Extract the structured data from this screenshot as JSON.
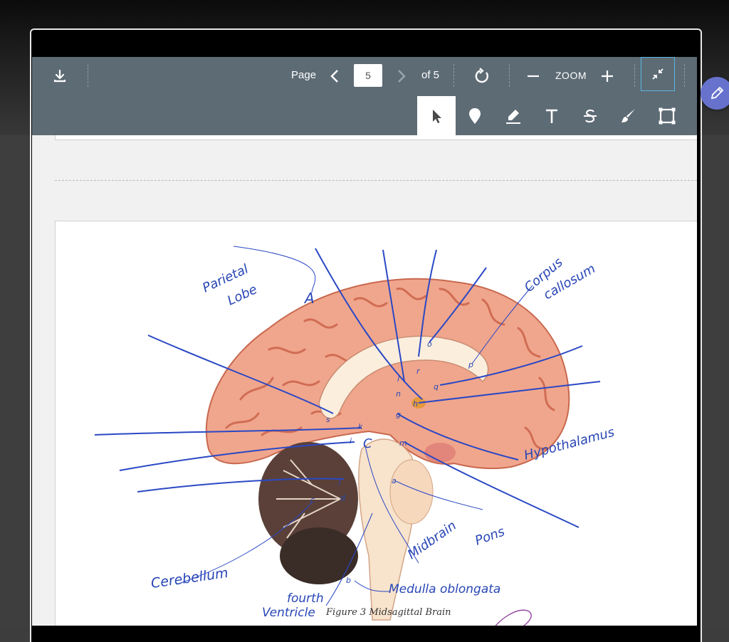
{
  "toolbar": {
    "page_label": "Page",
    "page_value": "5",
    "of_label": "of 5",
    "zoom_label": "ZOOM",
    "icons": [
      "download-icon",
      "chevron-left-icon",
      "chevron-right-icon",
      "rotate-icon",
      "minus-icon",
      "plus-icon",
      "collapse-icon"
    ]
  },
  "annotation_tools": [
    {
      "name": "select-tool",
      "icon": "cursor-arrow-icon",
      "active": true
    },
    {
      "name": "pin-tool",
      "icon": "pin-icon",
      "active": false
    },
    {
      "name": "highlight-tool",
      "icon": "highlighter-icon",
      "active": false
    },
    {
      "name": "text-tool",
      "icon": "text-icon",
      "active": false
    },
    {
      "name": "strikethrough-tool",
      "icon": "strikethrough-icon",
      "active": false
    },
    {
      "name": "draw-tool",
      "icon": "brush-icon",
      "active": false
    },
    {
      "name": "area-tool",
      "icon": "rectangle-icon",
      "active": false
    }
  ],
  "document": {
    "figure_caption": "Figure 3 Midsagittal Brain",
    "handwritten_labels": {
      "parietal_lobe_1": "Parietal",
      "parietal_lobe_2": "Lobe",
      "letter_a": "A",
      "corpus_callosum_1": "Corpus",
      "corpus_callosum_2": "callosum",
      "hypothalamus": "Hypothalamus",
      "pons": "Pons",
      "midbrain": "Midbrain",
      "cerebellum": "Cerebellum",
      "fourth_ventricle_1": "fourth",
      "fourth_ventricle_2": "Ventricle",
      "medulla": "Medulla oblongata",
      "letter_c": "C"
    },
    "point_letters": [
      "s",
      "k",
      "i",
      "j",
      "c",
      "d",
      "b",
      "n",
      "l",
      "r",
      "o",
      "p",
      "q",
      "h",
      "g",
      "m",
      "a"
    ]
  },
  "colors": {
    "toolbar": "#5d6b75",
    "ink": "#2946b5",
    "fab": "#6672cc",
    "accent_border": "#59b5e0"
  },
  "fab_icon": "pencil-icon"
}
